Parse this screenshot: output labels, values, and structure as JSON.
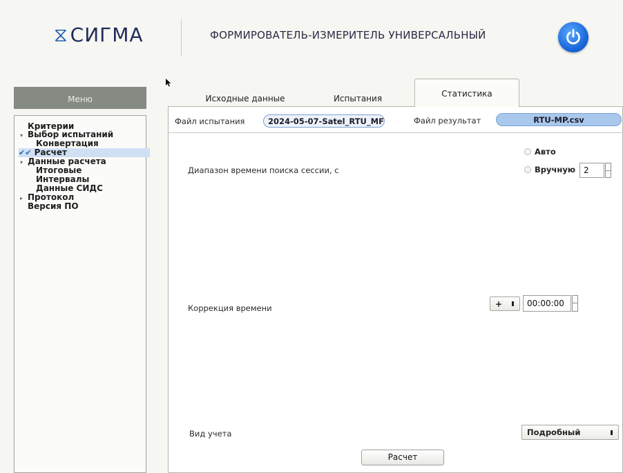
{
  "header": {
    "logo_text": "СИГМА",
    "logo_icon": "hourglass-sigma-icon",
    "title": "ФОРМИРОВАТЕЛЬ-ИЗМЕРИТЕЛЬ УНИВЕРСАЛЬНЫЙ",
    "power_icon": "power-icon",
    "brand_color": "#1e5fb0"
  },
  "sidebar": {
    "title": "Меню",
    "items": [
      {
        "label": "Критерии"
      },
      {
        "label": "Выбор испытаний"
      },
      {
        "label": "Конвертация"
      },
      {
        "label": "Расчет"
      },
      {
        "label": "Данные расчета"
      },
      {
        "label": "Итоговые"
      },
      {
        "label": "Интервалы"
      },
      {
        "label": "Данные СИДС"
      },
      {
        "label": "Протокол"
      },
      {
        "label": "Версия ПО"
      }
    ],
    "selected": "Расчет"
  },
  "tabs": [
    {
      "label": "Исходные данные"
    },
    {
      "label": "Испытания"
    },
    {
      "label": "Статистика"
    }
  ],
  "active_tab": "Статистика",
  "files": {
    "test_label": "Файл испытания",
    "test_value": "2024-05-07-Satel_RTU_MF",
    "result_label": "Файл результат",
    "result_value": "RTU-MP.csv"
  },
  "session_search": {
    "label": "Диапазон времени поиска сессии, с",
    "option_auto": "Авто",
    "option_manual": "Вручную",
    "value": "2"
  },
  "time_correction": {
    "label": "Коррекция времени",
    "sign": "+",
    "value": "00:00:00"
  },
  "accounting": {
    "label": "Вид учета",
    "value": "Подробный"
  },
  "calc_button_label": "Расчет"
}
